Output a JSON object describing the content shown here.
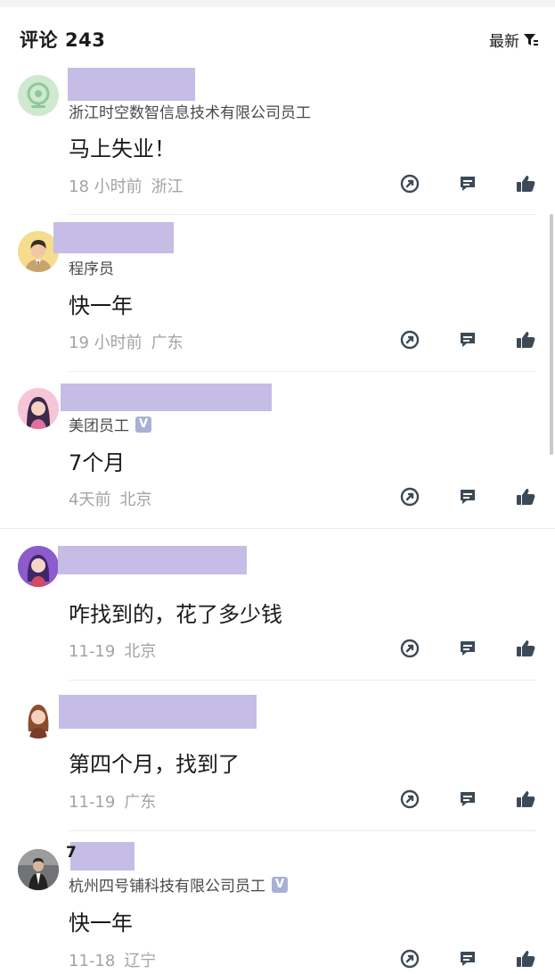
{
  "header": {
    "title": "评论",
    "count": "243",
    "sort_label": "最新",
    "sort_icon": "filter-icon"
  },
  "comments": [
    {
      "company": "浙江时空数智信息技术有限公司员工",
      "verified": false,
      "text": "马上失业！",
      "time": "18 小时前",
      "location": "浙江",
      "avatar": "webcam-avatar"
    },
    {
      "company": "程序员",
      "verified": false,
      "text": "快一年",
      "time": "19 小时前",
      "location": "广东",
      "avatar": "man-in-suit-avatar"
    },
    {
      "company": "美团员工",
      "verified": true,
      "text": "7个月",
      "time": "4天前",
      "location": "北京",
      "avatar": "woman-pink-avatar"
    },
    {
      "company": "",
      "verified": false,
      "text": "咋找到的，花了多少钱",
      "time": "11-19",
      "location": "北京",
      "avatar": "woman-purple-avatar"
    },
    {
      "company": "",
      "verified": false,
      "text": "第四个月，找到了",
      "time": "11-19",
      "location": "广东",
      "avatar": "woman-brown-hair-avatar"
    },
    {
      "name_fragment": "7",
      "company": "杭州四号铺科技有限公司员工",
      "verified": true,
      "text": "快一年",
      "time": "11-18",
      "location": "辽宁",
      "avatar": "man-photo-avatar"
    }
  ],
  "badge_text": "V",
  "actions": [
    "share-icon",
    "reply-icon",
    "like-icon"
  ],
  "colors": {
    "redaction": "#c5bde6",
    "icon": "#3c4a57",
    "meta_text": "#a3a3a3",
    "badge": "#a9b0d6"
  }
}
